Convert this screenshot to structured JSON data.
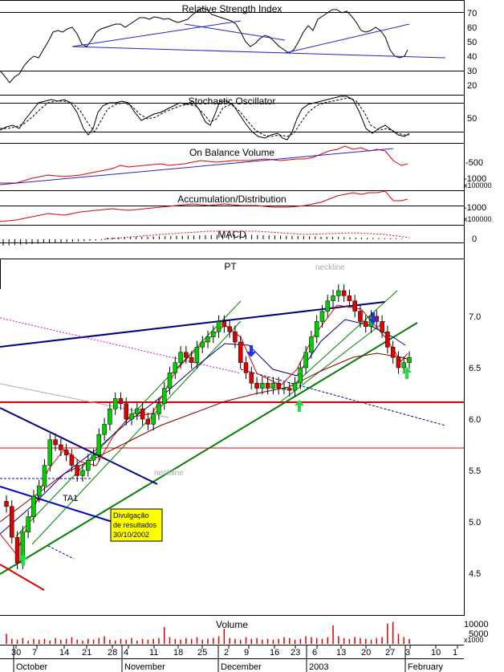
{
  "chart_data": {
    "type": "candlestick",
    "ticker": "PT",
    "panels": {
      "rsi": {
        "title": "Relative Strength Index",
        "ticks": [
          "70",
          "60",
          "50",
          "40",
          "30",
          "20"
        ],
        "ylim": [
          14,
          75
        ]
      },
      "stoch": {
        "title": "Stochastic Oscillator",
        "ticks": [
          "50"
        ]
      },
      "obv": {
        "title": "On Balance Volume",
        "ticks": [
          "-500",
          "-1000"
        ],
        "unit": "x100000"
      },
      "ad": {
        "title": "Accumulation/Distribution",
        "ticks": [
          "-1000"
        ],
        "unit": "x100000"
      },
      "macd": {
        "title": "MACD",
        "ticks": [
          "0"
        ]
      },
      "volume": {
        "title": "Volume",
        "ticks": [
          "10000",
          "5000"
        ],
        "unit": "x1000"
      }
    },
    "price": {
      "ticks": [
        "7.0",
        "6.5",
        "6.0",
        "5.5",
        "5.0",
        "4.5"
      ],
      "ylim": [
        4.15,
        7.55
      ],
      "annotations": {
        "neckline_top": "neckline",
        "neckline_bottom": "neckline",
        "ta1": "TA1"
      },
      "note": {
        "line1": "Divulgação",
        "line2": "de resultados",
        "line3": "30/10/2002"
      },
      "close": [
        5.15,
        4.85,
        4.6,
        4.9,
        5.05,
        5.25,
        5.35,
        5.55,
        5.8,
        5.75,
        5.7,
        5.65,
        5.55,
        5.45,
        5.5,
        5.6,
        5.65,
        5.85,
        5.95,
        6.1,
        6.2,
        6.15,
        6.0,
        6.05,
        6.1,
        6.0,
        5.95,
        6.05,
        6.15,
        6.3,
        6.45,
        6.55,
        6.65,
        6.6,
        6.55,
        6.7,
        6.75,
        6.8,
        6.85,
        6.95,
        6.9,
        6.85,
        6.75,
        6.55,
        6.45,
        6.35,
        6.3,
        6.35,
        6.3,
        6.35,
        6.3,
        6.3,
        6.28,
        6.35,
        6.5,
        6.65,
        6.8,
        6.95,
        7.05,
        7.15,
        7.2,
        7.25,
        7.2,
        7.15,
        7.05,
        6.95,
        6.9,
        7.0,
        6.95,
        6.85,
        6.7,
        6.6,
        6.5,
        6.55,
        6.6
      ]
    },
    "x_labels": {
      "days": [
        "30",
        "7",
        "14",
        "21",
        "28",
        "4",
        "11",
        "18",
        "25",
        "2",
        "9",
        "16",
        "23",
        "6",
        "13",
        "20",
        "27",
        "3",
        "10",
        "1"
      ],
      "months": [
        "October",
        "November",
        "December",
        "2003",
        "February"
      ]
    },
    "volume": [
      12,
      6,
      5,
      7,
      4,
      6,
      5,
      6,
      4,
      7,
      5,
      6,
      8,
      5,
      4,
      6,
      5,
      7,
      9,
      5,
      4,
      6,
      5,
      7,
      4,
      6,
      5,
      6,
      7,
      20,
      8,
      6,
      5,
      7,
      6,
      8,
      5,
      6,
      7,
      9,
      18,
      7,
      6,
      5,
      8,
      6,
      7,
      5,
      6,
      5,
      6,
      8,
      7,
      5,
      6,
      9,
      8,
      7,
      6,
      8,
      22,
      9,
      7,
      6,
      8,
      7,
      6,
      5,
      7,
      8,
      24,
      26,
      12,
      8,
      6
    ]
  }
}
